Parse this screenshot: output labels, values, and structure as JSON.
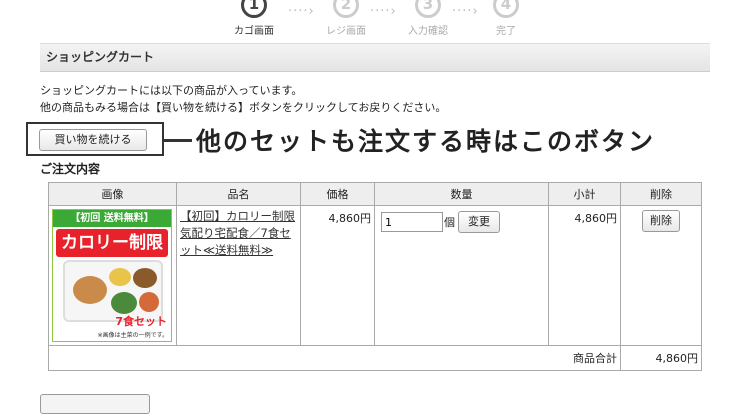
{
  "steps": [
    {
      "num": "1",
      "label": "カゴ画面"
    },
    {
      "num": "2",
      "label": "レジ画面"
    },
    {
      "num": "3",
      "label": "入力確認"
    },
    {
      "num": "4",
      "label": "完了"
    }
  ],
  "header": {
    "title": "ショッピングカート"
  },
  "intro": {
    "line1": "ショッピングカートには以下の商品が入っています。",
    "line2": "他の商品もみる場合は【買い物を続ける】ボタンをクリックしてお戻りください。"
  },
  "continue_button": "買い物を続ける",
  "callout": "他のセットも注文する時はこのボタン",
  "order": {
    "title": "ご注文内容",
    "columns": [
      "画像",
      "品名",
      "価格",
      "数量",
      "小計",
      "削除"
    ],
    "item": {
      "image": {
        "top": "【初回 送料無料】",
        "title": "カロリー制限",
        "badge": "7食セット",
        "note": "※画像は主菜の一例です。"
      },
      "name": "【初回】カロリー制限気配り宅配食／7食セット≪送料無料≫",
      "price": "4,860円",
      "quantity": "1",
      "unit": "個",
      "update_label": "変更",
      "subtotal": "4,860円",
      "delete_label": "削除"
    },
    "total_label": "商品合計",
    "total_value": "4,860円"
  }
}
